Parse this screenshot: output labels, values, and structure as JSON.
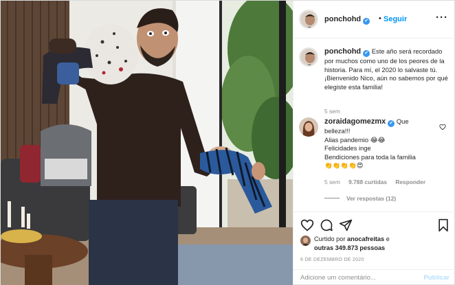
{
  "post": {
    "author": "ponchohd",
    "follow_sep": "•",
    "follow_label": "Seguir",
    "more_icon": "more-horizontal-icon",
    "verified_mark": "✔"
  },
  "caption": {
    "username": "ponchohd",
    "text": "Este año será recordado por muchos como uno de los peores de la historia. Para mí, el 2020 lo salvaste tú. ¡Bienvenido Nico, aún no sabemos por qué elegiste esta familia!",
    "time": "5 sem"
  },
  "comment": {
    "username": "zoraidagomezmx",
    "lines": [
      "Que",
      "belleza!!!",
      "Alias pandemio 😂😂",
      "Felicidades inge",
      "Bendiciones para toda la familia",
      "👏👏👏👏😍"
    ],
    "time": "5 sem",
    "likes": "9.788 curtidas",
    "reply": "Responder",
    "view_replies": "Ver respostas (12)"
  },
  "likes": {
    "prefix": "Curtido por",
    "user": "anocafreitas",
    "middle": "e",
    "others": "outras 349.873 pessoas"
  },
  "date": "6 DE DEZEMBRO DE 2020",
  "add_comment": {
    "placeholder": "Adicione um comentário...",
    "publish": "Publicar"
  },
  "colors": {
    "link_blue": "#0095f6",
    "verified_blue": "#3897f0",
    "muted": "#8e8e8e",
    "publish_disabled": "#b2dffc"
  },
  "icons": [
    "heart-icon",
    "comment-icon",
    "share-icon",
    "bookmark-icon",
    "verified-badge-icon",
    "more-horizontal-icon"
  ]
}
